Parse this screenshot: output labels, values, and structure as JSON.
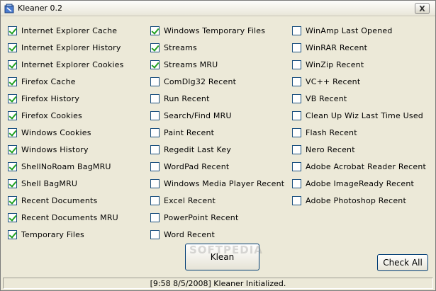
{
  "window": {
    "title": "Kleaner 0.2",
    "close_glyph": "X"
  },
  "columns": [
    [
      {
        "label": "Internet Explorer Cache",
        "checked": true
      },
      {
        "label": "Internet Explorer History",
        "checked": true
      },
      {
        "label": "Internet Explorer Cookies",
        "checked": true
      },
      {
        "label": "Firefox Cache",
        "checked": true
      },
      {
        "label": "Firefox History",
        "checked": true
      },
      {
        "label": "Firefox Cookies",
        "checked": true
      },
      {
        "label": "Windows Cookies",
        "checked": true
      },
      {
        "label": "Windows History",
        "checked": true
      },
      {
        "label": "ShellNoRoam BagMRU",
        "checked": true
      },
      {
        "label": "Shell BagMRU",
        "checked": true
      },
      {
        "label": "Recent Documents",
        "checked": true
      },
      {
        "label": "Recent Documents MRU",
        "checked": true
      },
      {
        "label": "Temporary Files",
        "checked": true
      }
    ],
    [
      {
        "label": "Windows Temporary Files",
        "checked": true
      },
      {
        "label": "Streams",
        "checked": true
      },
      {
        "label": "Streams MRU",
        "checked": true
      },
      {
        "label": "ComDlg32 Recent",
        "checked": false
      },
      {
        "label": "Run Recent",
        "checked": false
      },
      {
        "label": "Search/Find MRU",
        "checked": false
      },
      {
        "label": "Paint Recent",
        "checked": false
      },
      {
        "label": "Regedit Last Key",
        "checked": false
      },
      {
        "label": "WordPad Recent",
        "checked": false
      },
      {
        "label": "Windows Media Player Recent",
        "checked": false
      },
      {
        "label": "Excel Recent",
        "checked": false
      },
      {
        "label": "PowerPoint Recent",
        "checked": false
      },
      {
        "label": "Word Recent",
        "checked": false
      }
    ],
    [
      {
        "label": "WinAmp Last Opened",
        "checked": false
      },
      {
        "label": "WinRAR Recent",
        "checked": false
      },
      {
        "label": "WinZip Recent",
        "checked": false
      },
      {
        "label": "VC++ Recent",
        "checked": false
      },
      {
        "label": "VB Recent",
        "checked": false
      },
      {
        "label": "Clean Up Wiz Last Time Used",
        "checked": false
      },
      {
        "label": "Flash Recent",
        "checked": false
      },
      {
        "label": "Nero Recent",
        "checked": false
      },
      {
        "label": "Adobe Acrobat Reader Recent",
        "checked": false
      },
      {
        "label": "Adobe ImageReady Recent",
        "checked": false
      },
      {
        "label": "Adobe Photoshop Recent",
        "checked": false
      }
    ]
  ],
  "buttons": {
    "klean_label": "Klean",
    "check_all_label": "Check All"
  },
  "watermark": "SOFTPEDIA",
  "status": {
    "text": "[9:58 8/5/2008] Kleaner Initialized."
  },
  "colors": {
    "check_green": "#21a121",
    "checkbox_border": "#1c5180",
    "window_bg": "#ece9d8"
  }
}
